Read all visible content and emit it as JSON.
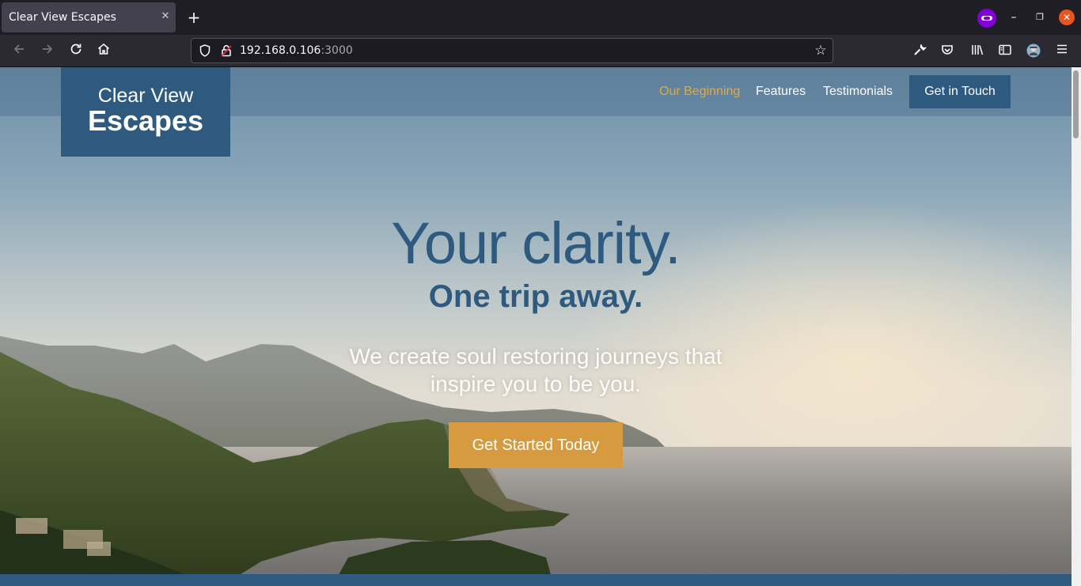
{
  "browser": {
    "tab_title": "Clear View Escapes",
    "tab_close": "✕",
    "new_tab": "+",
    "url_host": "192.168.0.106",
    "url_port": ":3000",
    "icons": [
      "back-icon",
      "forward-icon",
      "reload-icon",
      "home-icon",
      "shield-icon",
      "lock-icon",
      "star-icon",
      "wrench-icon",
      "pocket-icon",
      "library-icon",
      "sidebar-icon",
      "account-icon",
      "menu-icon",
      "private-browsing-icon"
    ]
  },
  "site": {
    "logo_line1": "Clear View",
    "logo_line2": "Escapes",
    "nav": [
      {
        "label": "Our Beginning",
        "active": true
      },
      {
        "label": "Features",
        "active": false
      },
      {
        "label": "Testimonials",
        "active": false
      }
    ],
    "nav_cta": "Get in Touch",
    "hero_title": "Your clarity.",
    "hero_subtitle": "One trip away.",
    "hero_text": "We create soul restoring journeys that inspire you to be you.",
    "hero_button": "Get Started Today",
    "colors": {
      "brand_blue": "#2f5a80",
      "accent_gold": "#d79a3f",
      "active_link": "#e0a84c"
    }
  }
}
